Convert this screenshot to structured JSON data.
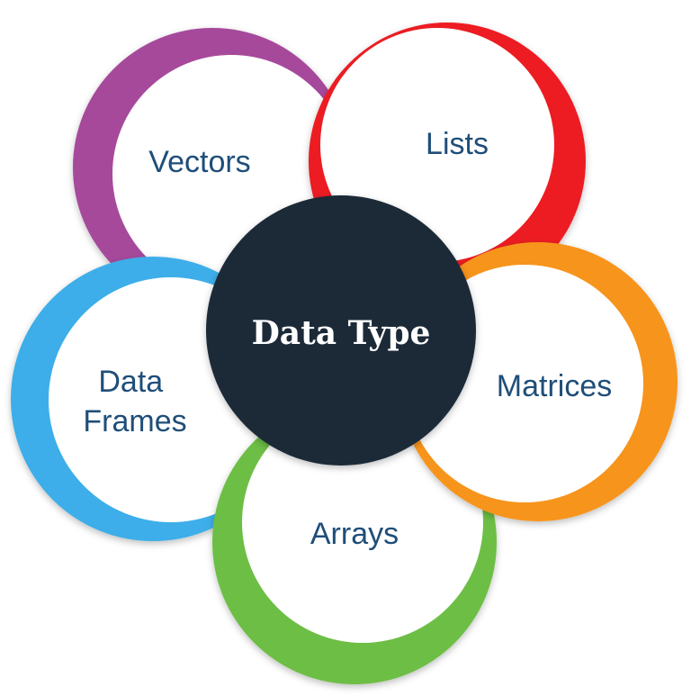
{
  "title": "Data Type",
  "items": [
    {
      "label": "Vectors",
      "color": "#a6499b"
    },
    {
      "label": "Lists",
      "color": "#ec1c24"
    },
    {
      "label": "Matrices",
      "color": "#f7941d"
    },
    {
      "label": "Arrays",
      "color": "#6dbe45"
    },
    {
      "label": [
        "Data",
        "Frames"
      ],
      "color": "#3daee9"
    }
  ],
  "colors": {
    "center_fill": "#1b2a38",
    "label_text": "#1f4e79",
    "center_text": "#ffffff"
  }
}
